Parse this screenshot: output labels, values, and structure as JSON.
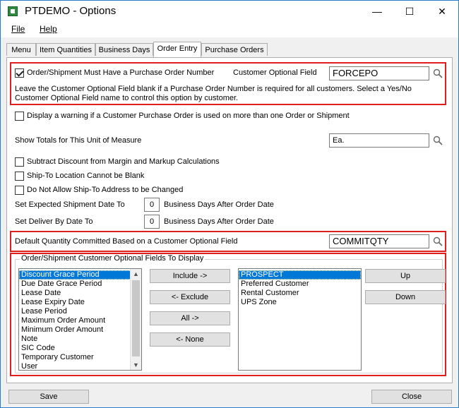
{
  "window": {
    "title": "PTDEMO - Options",
    "minimize": "—",
    "maximize": "☐",
    "close": "✕"
  },
  "menu": {
    "file": "File",
    "help": "Help"
  },
  "tabs": [
    "Menu",
    "Item Quantities",
    "Business Days",
    "Order Entry",
    "Purchase Orders"
  ],
  "order_entry": {
    "po_required_label": "Order/Shipment Must Have a Purchase Order Number",
    "po_required_checked": true,
    "customer_optional_field_label": "Customer Optional Field",
    "customer_optional_field_value": "FORCEPO",
    "po_help_text": "Leave the Customer Optional Field blank if a Purchase Order Number is required for all customers. Select a Yes/No Customer Optional Field name to control this option by customer.",
    "warn_duplicate_po_label": "Display a warning if a Customer Purchase Order is used on more than one Order or Shipment",
    "show_totals_label": "Show Totals for This Unit of Measure",
    "show_totals_value": "Ea.",
    "subtract_discount_label": "Subtract Discount from Margin and Markup Calculations",
    "shipto_not_blank_label": "Ship-To Location Cannot be Blank",
    "no_shipto_change_label": "Do Not Allow Ship-To Address to be Changed",
    "expected_ship_label": "Set Expected Shipment Date To",
    "expected_ship_value": "0",
    "expected_ship_suffix": "Business Days After Order Date",
    "deliver_by_label": "Set Deliver By Date To",
    "deliver_by_value": "0",
    "deliver_by_suffix": "Business Days After Order Date",
    "default_qty_label": "Default Quantity Committed Based on a Customer Optional Field",
    "default_qty_value": "COMMITQTY",
    "fields_group_label": "Order/Shipment Customer Optional Fields To Display",
    "available_fields": [
      "Discount Grace Period",
      "Due Date Grace Period",
      "Lease Date",
      "Lease Expiry Date",
      "Lease Period",
      "Maximum Order Amount",
      "Minimum Order Amount",
      "Note",
      "SIC Code",
      "Temporary Customer",
      "User"
    ],
    "selected_fields": [
      "PROSPECT",
      "Preferred Customer",
      "Rental Customer",
      "UPS Zone"
    ],
    "include_btn": "Include ->",
    "exclude_btn": "<- Exclude",
    "all_btn": "All ->",
    "none_btn": "<- None",
    "up_btn": "Up",
    "down_btn": "Down"
  },
  "footer": {
    "save": "Save",
    "close": "Close"
  }
}
